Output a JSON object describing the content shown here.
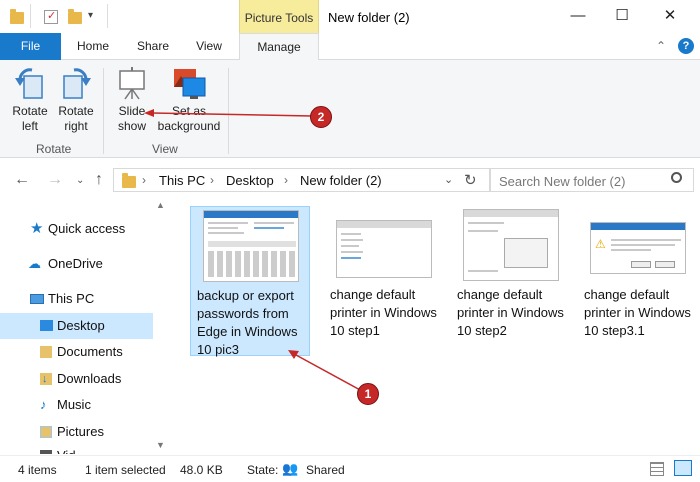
{
  "window": {
    "contextual_tab_group": "Picture Tools",
    "title": "New folder (2)",
    "controls": {
      "minimize": "—",
      "maximize": "☐",
      "close": "✕"
    }
  },
  "ribbon": {
    "tabs": [
      {
        "label": "File"
      },
      {
        "label": "Home"
      },
      {
        "label": "Share"
      },
      {
        "label": "View"
      },
      {
        "label": "Manage"
      }
    ],
    "buttons": {
      "rotate_left": {
        "line1": "Rotate",
        "line2": "left"
      },
      "rotate_right": {
        "line1": "Rotate",
        "line2": "right"
      },
      "slide_show": {
        "line1": "Slide",
        "line2": "show"
      },
      "set_as_background": {
        "line1": "Set as",
        "line2": "background"
      }
    },
    "groups": {
      "rotate": "Rotate",
      "view": "View"
    }
  },
  "address": {
    "crumbs": [
      "This PC",
      "Desktop",
      "New folder (2)"
    ],
    "search_placeholder": "Search New folder (2)"
  },
  "nav_pane": {
    "items": [
      {
        "label": "Quick access",
        "icon": "star-icon"
      },
      {
        "label": "OneDrive",
        "icon": "cloud-icon"
      },
      {
        "label": "This PC",
        "icon": "computer-icon"
      },
      {
        "label": "Desktop",
        "icon": "folder-icon",
        "selected": true
      },
      {
        "label": "Documents",
        "icon": "documents-icon"
      },
      {
        "label": "Downloads",
        "icon": "downloads-icon"
      },
      {
        "label": "Music",
        "icon": "music-icon"
      },
      {
        "label": "Pictures",
        "icon": "pictures-icon"
      },
      {
        "label": "Vid",
        "icon": "videos-icon"
      }
    ]
  },
  "files": [
    {
      "name": "backup or export passwords from Edge in Windows 10 pic3",
      "selected": true
    },
    {
      "name": "change default printer in Windows 10 step1"
    },
    {
      "name": "change default printer in Windows 10 step2"
    },
    {
      "name": "change default printer in Windows 10 step3.1"
    }
  ],
  "annotations": {
    "badge1": "1",
    "badge2": "2",
    "color": "#c62828"
  },
  "status": {
    "item_count": "4 items",
    "selection": "1 item selected",
    "size": "48.0 KB",
    "state_label": "State:",
    "state_value": "Shared"
  },
  "colors": {
    "accent": "#1979ca",
    "selection": "#cce8ff",
    "contextual": "#f7ec9c"
  }
}
